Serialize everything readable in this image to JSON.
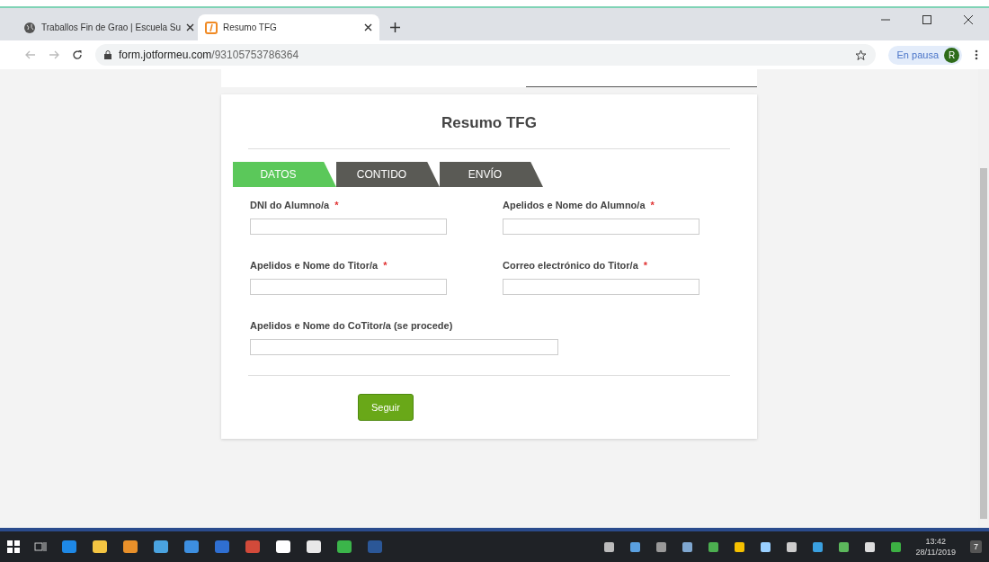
{
  "browser": {
    "tabs": [
      {
        "title": "Traballos Fin de Grao | Escuela Su",
        "selected": false,
        "kind": "site"
      },
      {
        "title": "Resumo TFG",
        "selected": true,
        "kind": "form"
      }
    ],
    "url_domain": "form.jotformeu.com",
    "url_path": "/93105753786364",
    "profile_label": "En pausa",
    "avatar_letter": "R"
  },
  "form": {
    "title": "Resumo TFG",
    "steps": [
      {
        "label": "DATOS",
        "selected": true
      },
      {
        "label": "CONTIDO",
        "selected": false
      },
      {
        "label": "ENVÍO",
        "selected": false
      }
    ],
    "fields": [
      {
        "label": "DNI do Alumno/a",
        "mark": "*",
        "kind": "half"
      },
      {
        "label": "Apelidos e Nome do Alumno/a",
        "mark": "*",
        "kind": "half"
      },
      {
        "label": "Apelidos e Nome do Titor/a",
        "mark": "*",
        "kind": "half"
      },
      {
        "label": "Correo electrónico do Titor/a",
        "mark": "*",
        "kind": "half"
      },
      {
        "label": "Apelidos e Nome do CoTitor/a (se procede)",
        "kind": "wide"
      }
    ],
    "submit": "Seguir"
  },
  "taskbar": {
    "time": "13:42",
    "date": "28/11/2019",
    "notifications": "7"
  }
}
